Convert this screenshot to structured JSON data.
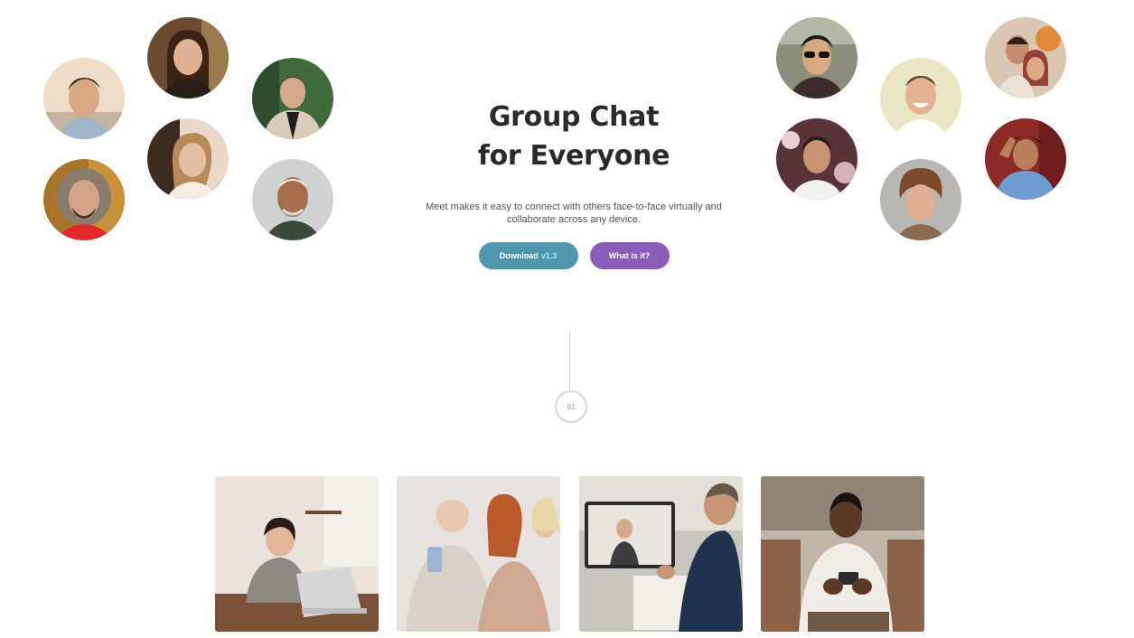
{
  "hero": {
    "title_line1": "Group Chat",
    "title_line2": "for Everyone",
    "description": "Meet makes it easy to connect with others face-to-face virtually and collaborate across any device.",
    "download_label": "Download",
    "download_version": "v1.3",
    "what_label": "What is it?"
  },
  "step": {
    "number": "01"
  },
  "colors": {
    "download_button": "#4f97ac",
    "what_button": "#8a5db9",
    "version_text": "#a8e6f0"
  }
}
